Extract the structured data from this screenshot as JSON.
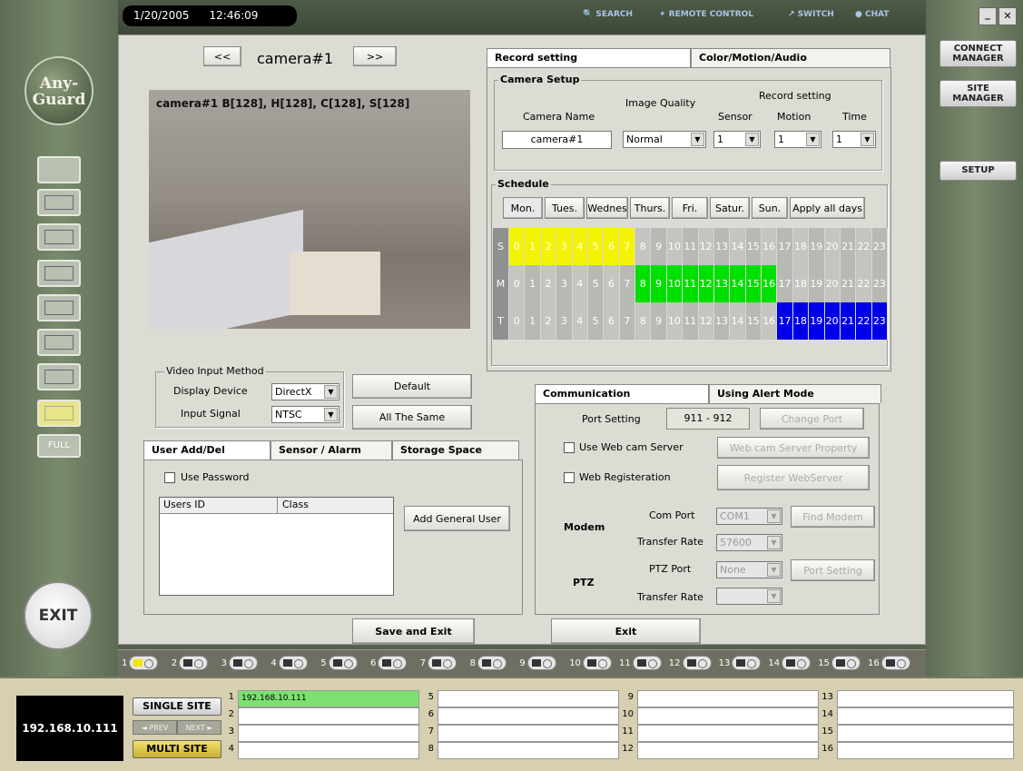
{
  "topbar": {
    "date": "1/20/2005",
    "time": "12:46:09",
    "search": "SEARCH",
    "remote": "REMOTE CONTROL",
    "switch": "SWITCH",
    "chat": "CHAT"
  },
  "logo": {
    "line1": "Any-",
    "line2": "Guard"
  },
  "left": {
    "full": "FULL",
    "exit": "EXIT"
  },
  "right": {
    "connect": "CONNECT MANAGER",
    "site": "SITE MANAGER",
    "setup": "SETUP"
  },
  "camera": {
    "prev": "<<",
    "next": ">>",
    "name": "camera#1",
    "overlay": "camera#1   B[128], H[128], C[128], S[128]"
  },
  "video_input": {
    "legend": "Video Input Method",
    "display_label": "Display Device",
    "display_value": "DirectX",
    "signal_label": "Input Signal",
    "signal_value": "NTSC",
    "default_btn": "Default",
    "same_btn": "All The Same"
  },
  "tabs_left": [
    "User Add/Del",
    "Sensor / Alarm",
    "Storage Space"
  ],
  "users": {
    "use_password": "Use Password",
    "col_id": "Users ID",
    "col_class": "Class",
    "add_btn": "Add General User"
  },
  "record_tabs": [
    "Record setting",
    "Color/Motion/Audio"
  ],
  "camera_setup": {
    "legend": "Camera Setup",
    "camera_name_label": "Camera Name",
    "image_quality_label": "Image Quality",
    "record_setting_label": "Record setting",
    "sensor_label": "Sensor",
    "motion_label": "Motion",
    "time_label": "Time",
    "camera_name_value": "camera#1",
    "quality_value": "Normal",
    "sensor_value": "1",
    "motion_value": "1",
    "time_value": "1"
  },
  "schedule": {
    "legend": "Schedule",
    "days": [
      "Mon.",
      "Tues.",
      "Wednes",
      "Thurs.",
      "Fri.",
      "Satur.",
      "Sun."
    ],
    "apply": "Apply all days",
    "rows": [
      {
        "label": "S",
        "color": "#f4f400",
        "on_hours": [
          0,
          1,
          2,
          3,
          4,
          5,
          6,
          7
        ]
      },
      {
        "label": "M",
        "color": "#00e000",
        "on_hours": [
          8,
          9,
          10,
          11,
          12,
          13,
          14,
          15,
          16
        ]
      },
      {
        "label": "T",
        "color": "#0000e8",
        "on_hours": [
          17,
          18,
          19,
          20,
          21,
          22,
          23
        ]
      }
    ]
  },
  "comm_tabs": [
    "Communication",
    "Using Alert Mode"
  ],
  "comm": {
    "port_label": "Port Setting",
    "port_value": "911 - 912",
    "change_port": "Change Port",
    "webcam": "Use Web cam Server",
    "webcam_prop": "Web cam Server Property",
    "webreg": "Web Registeration",
    "register": "Register WebServer",
    "modem": "Modem",
    "com_port": "Com Port",
    "com_value": "COM1",
    "find_modem": "Find Modem",
    "transfer_rate": "Transfer Rate",
    "rate_value": "57600",
    "ptz": "PTZ",
    "ptz_port": "PTZ Port",
    "ptz_value": "None",
    "port_setting": "Port Setting",
    "ptz_rate": "Transfer Rate"
  },
  "actions": {
    "save": "Save and Exit",
    "exit": "Exit"
  },
  "channels": [
    "1",
    "2",
    "3",
    "4",
    "5",
    "6",
    "7",
    "8",
    "9",
    "10",
    "11",
    "12",
    "13",
    "14",
    "15",
    "16"
  ],
  "footer": {
    "ip": "192.168.10.111",
    "single": "SINGLE SITE",
    "prev": "◄ PREV",
    "next": "NEXT ►",
    "multi": "MULTI SITE",
    "sites": [
      {
        "n": "1",
        "v": "192.168.10.111"
      },
      {
        "n": "2",
        "v": ""
      },
      {
        "n": "3",
        "v": ""
      },
      {
        "n": "4",
        "v": ""
      },
      {
        "n": "5",
        "v": ""
      },
      {
        "n": "6",
        "v": ""
      },
      {
        "n": "7",
        "v": ""
      },
      {
        "n": "8",
        "v": ""
      },
      {
        "n": "9",
        "v": ""
      },
      {
        "n": "10",
        "v": ""
      },
      {
        "n": "11",
        "v": ""
      },
      {
        "n": "12",
        "v": ""
      },
      {
        "n": "13",
        "v": ""
      },
      {
        "n": "14",
        "v": ""
      },
      {
        "n": "15",
        "v": ""
      },
      {
        "n": "16",
        "v": ""
      }
    ]
  }
}
